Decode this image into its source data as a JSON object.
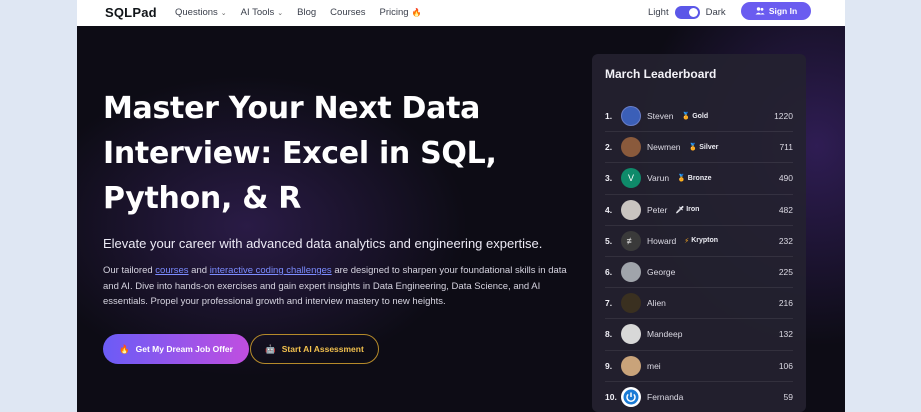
{
  "nav": {
    "brand": "SQLPad",
    "links": [
      {
        "label": "Questions",
        "has_dropdown": true
      },
      {
        "label": "AI Tools",
        "has_dropdown": true
      },
      {
        "label": "Blog"
      },
      {
        "label": "Courses"
      },
      {
        "label": "Pricing",
        "icon": "fire-icon"
      }
    ],
    "theme_light": "Light",
    "theme_dark": "Dark",
    "theme_state": "dark",
    "signin_label": "Sign In"
  },
  "hero": {
    "title": "Master Your Next Data Interview: Excel in SQL, Python, & R",
    "subtitle": "Elevate your career with advanced data analytics and engineering expertise.",
    "para_1": "Our tailored ",
    "link_courses": "courses",
    "para_2": " and ",
    "link_challenges": "interactive coding challenges",
    "para_3": " are designed to sharpen your foundational skills in data and AI. Dive into hands-on exercises and gain expert insights in Data Engineering, Data Science, and AI essentials. Propel your professional growth and interview mastery to new heights.",
    "cta_primary": "Get My Dream Job Offer",
    "cta_secondary": "Start AI Assessment"
  },
  "leaderboard": {
    "title": "March Leaderboard",
    "rows": [
      {
        "rank": "1.",
        "name": "Steven",
        "badge": "Gold",
        "score": "1220",
        "avatar_color": "#3b5fb8"
      },
      {
        "rank": "2.",
        "name": "Newmen",
        "badge": "Silver",
        "score": "711",
        "avatar_color": "#8a5a3c"
      },
      {
        "rank": "3.",
        "name": "Varun",
        "badge": "Bronze",
        "score": "490",
        "avatar_color": "#0f8a6a"
      },
      {
        "rank": "4.",
        "name": "Peter",
        "badge": "Iron",
        "score": "482",
        "avatar_color": "#c9c4c0"
      },
      {
        "rank": "5.",
        "name": "Howard",
        "badge": "Krypton",
        "score": "232",
        "avatar_color": "#3a3a3a"
      },
      {
        "rank": "6.",
        "name": "George",
        "badge": "",
        "score": "225",
        "avatar_color": "#a0a4ab"
      },
      {
        "rank": "7.",
        "name": "Alien",
        "badge": "",
        "score": "216",
        "avatar_color": "#3a3020"
      },
      {
        "rank": "8.",
        "name": "Mandeep",
        "badge": "",
        "score": "132",
        "avatar_color": "#d8d8d8"
      },
      {
        "rank": "9.",
        "name": "mei",
        "badge": "",
        "score": "106",
        "avatar_color": "#c9a37a"
      },
      {
        "rank": "10.",
        "name": "Fernanda",
        "badge": "",
        "score": "59",
        "avatar_color": "#1a7bd6"
      }
    ]
  }
}
